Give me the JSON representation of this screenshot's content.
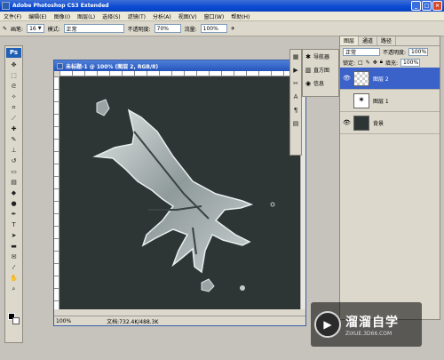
{
  "app": {
    "title": "Adobe Photoshop CS3 Extended"
  },
  "menu": [
    "文件(F)",
    "编辑(E)",
    "图像(I)",
    "图层(L)",
    "选择(S)",
    "滤镜(T)",
    "分析(A)",
    "视图(V)",
    "窗口(W)",
    "帮助(H)"
  ],
  "options": {
    "brush_label": "画笔:",
    "brush_size": "16",
    "mode_label": "模式:",
    "mode_value": "正常",
    "opacity_label": "不透明度:",
    "opacity_value": "70%",
    "flow_label": "流量:",
    "flow_value": "100%"
  },
  "toolbox": {
    "badge": "Ps"
  },
  "document": {
    "title": "未标题-1 @ 100% (图层 2, RGB/8)",
    "zoom": "100%",
    "doc_info": "文档:732.4K/488.3K"
  },
  "nav_panel": {
    "items": [
      {
        "label": "导航器",
        "icon": "navigator-icon"
      },
      {
        "label": "直方图",
        "icon": "histogram-icon"
      },
      {
        "label": "信息",
        "icon": "info-icon"
      }
    ]
  },
  "layers_panel": {
    "tabs": [
      "图层",
      "通道",
      "路径"
    ],
    "blend_mode": "正常",
    "opacity_label": "不透明度:",
    "opacity_value": "100%",
    "lock_label": "锁定:",
    "fill_label": "填充:",
    "fill_value": "100%",
    "layers": [
      {
        "name": "图层 2",
        "selected": true,
        "visible": true
      },
      {
        "name": "图层 1",
        "selected": false,
        "visible": false
      },
      {
        "name": "背景",
        "selected": false,
        "visible": true
      }
    ]
  },
  "watermark": {
    "logo": "▶",
    "name": "溜溜自学",
    "url": "ZIXUE.3D66.COM"
  }
}
